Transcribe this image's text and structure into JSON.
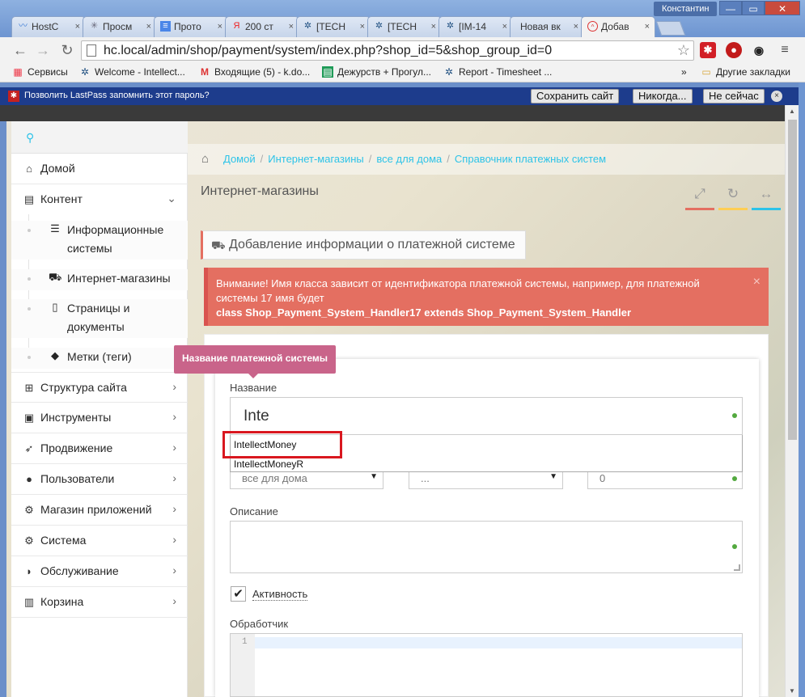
{
  "window": {
    "user": "Константин",
    "minimize": "—",
    "maximize": "▭",
    "close": "✕"
  },
  "tabs": [
    {
      "label": "HostC",
      "icon": "wave-icon"
    },
    {
      "label": "Просм",
      "icon": "asterisk-icon"
    },
    {
      "label": "Прото",
      "icon": "doc-icon"
    },
    {
      "label": "200 ст",
      "icon": "yandex-icon"
    },
    {
      "label": "[TECH",
      "icon": "jira-icon"
    },
    {
      "label": "[TECH",
      "icon": "jira-icon"
    },
    {
      "label": "[IM-14",
      "icon": "jira-icon"
    },
    {
      "label": "Новая вк",
      "icon": ""
    },
    {
      "label": "Добав",
      "icon": "hostcms-icon"
    }
  ],
  "toolbar": {
    "url": "hc.local/admin/shop/payment/system/index.php?shop_id=5&shop_group_id=0"
  },
  "bookmarks": [
    {
      "label": "Сервисы"
    },
    {
      "label": "Welcome - Intellect..."
    },
    {
      "label": "Входящие (5) - k.do..."
    },
    {
      "label": "Дежурств + Прогул..."
    },
    {
      "label": "Report - Timesheet ..."
    },
    {
      "label": "»"
    },
    {
      "label": "Другие закладки"
    }
  ],
  "lastpass": {
    "text": "Позволить LastPass запомнить этот пароль?",
    "save": "Сохранить сайт",
    "never": "Никогда...",
    "not_now": "Не сейчас",
    "close": "×"
  },
  "sidebar": {
    "items": [
      {
        "label": "Домой"
      },
      {
        "label": "Контент"
      },
      {
        "label": "Структура сайта"
      },
      {
        "label": "Инструменты"
      },
      {
        "label": "Продвижение"
      },
      {
        "label": "Пользователи"
      },
      {
        "label": "Магазин приложений"
      },
      {
        "label": "Система"
      },
      {
        "label": "Обслуживание"
      },
      {
        "label": "Корзина"
      }
    ],
    "sub_items": [
      {
        "label": "Информационные системы"
      },
      {
        "label": "Интернет-магазины"
      },
      {
        "label": "Страницы и документы"
      },
      {
        "label": "Метки (теги)"
      }
    ]
  },
  "breadcrumb": {
    "items": [
      "Домой",
      "Интернет-магазины",
      "все для дома",
      "Справочник платежных систем"
    ],
    "separator": "/"
  },
  "page": {
    "title": "Интернет-магазины"
  },
  "widget": {
    "title": "Добавление информации о платежной системе"
  },
  "alert": {
    "line1": "Внимание! Имя класса зависит от идентификатора платежной системы, например, для платежной системы 17 имя будет",
    "line2": "class Shop_Payment_System_Handler17 extends Shop_Payment_System_Handler",
    "close": "×"
  },
  "form": {
    "tooltip": "Название платежной системы",
    "name_label": "Название",
    "name_value": "Inte",
    "autocomplete": [
      "IntellectMoney",
      "IntellectMoneyR"
    ],
    "shop_select": "все для дома",
    "second_select": "...",
    "sort_value": "0",
    "description_label": "Описание",
    "active_label": "Активность",
    "handler_label": "Обработчик",
    "line_number": "1"
  },
  "colors": {
    "accent": "#2dc3e8",
    "alert": "#e46f61",
    "tooltip": "#c9648a",
    "tool_bar_1": "#e46f61",
    "tool_bar_2": "#ffce55",
    "tool_bar_3": "#2dc3e8"
  }
}
